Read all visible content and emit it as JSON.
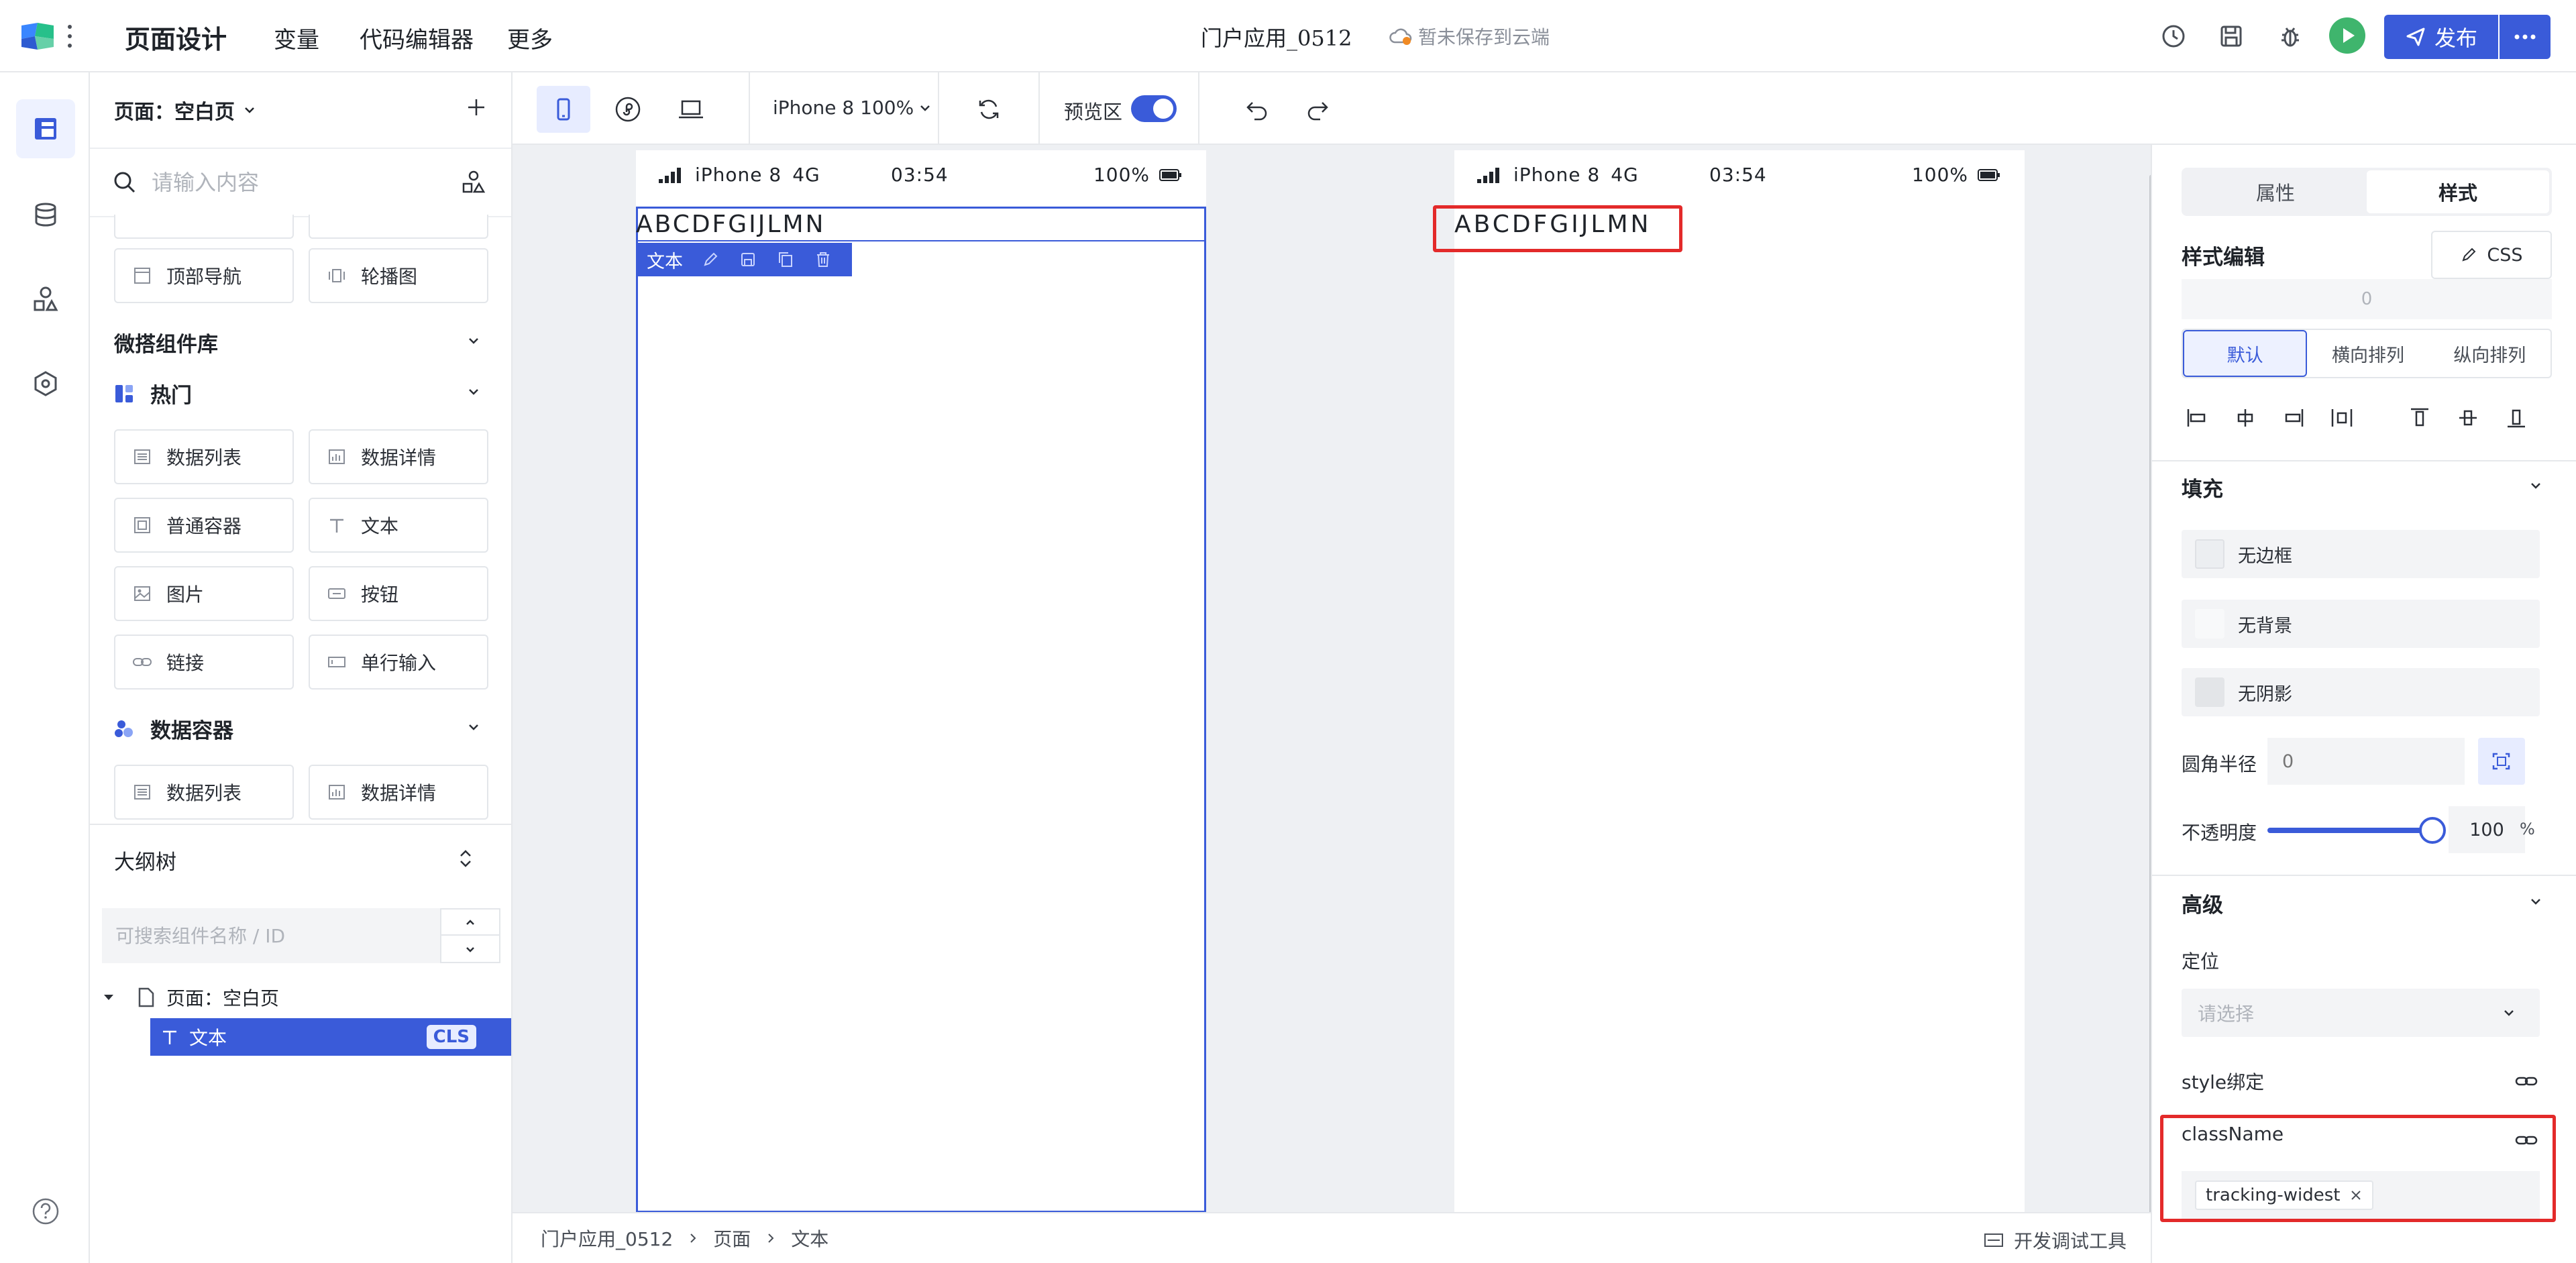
{
  "topbar": {
    "title": "页面设计",
    "menu": [
      "变量",
      "代码编辑器",
      "更多"
    ],
    "app_name": "门户应用_0512",
    "cloud_status": "暂未保存到云端",
    "publish_label": "发布"
  },
  "left_panel": {
    "page_select": "页面：空白页",
    "search_placeholder": "请输入内容",
    "top_cards": [
      "顶部导航",
      "轮播图"
    ],
    "library_title": "微搭组件库",
    "hot_title": "热门",
    "hot_cards": [
      "数据列表",
      "数据详情",
      "普通容器",
      "文本",
      "图片",
      "按钮",
      "链接",
      "单行输入"
    ],
    "data_container_title": "数据容器",
    "data_container_cards": [
      "数据列表",
      "数据详情"
    ],
    "outline_title": "大纲树",
    "outline_search_placeholder": "可搜索组件名称 / ID",
    "tree_page": "页面：空白页",
    "tree_text": "文本",
    "tree_badge": "CLS"
  },
  "canvas_toolbar": {
    "device": "iPhone 8 100%",
    "preview_label": "预览区",
    "preview_on": true
  },
  "phone": {
    "carrier": "iPhone 8",
    "network": "4G",
    "time": "03:54",
    "battery": "100%",
    "text": "ABCDFGIJLMN",
    "node_label": "文本"
  },
  "breadcrumb": {
    "items": [
      "门户应用_0512",
      "页面",
      "文本"
    ],
    "devtools": "开发调试工具"
  },
  "right_panel": {
    "tabs": [
      "属性",
      "样式"
    ],
    "active_tab": "样式",
    "style_edit_title": "样式编辑",
    "css_label": "CSS",
    "zero_value": "0",
    "layout_tabs": [
      "默认",
      "横向排列",
      "纵向排列"
    ],
    "fill_title": "填充",
    "fill_rows": [
      "无边框",
      "无背景",
      "无阴影"
    ],
    "radius_label": "圆角半径",
    "radius_value": "0",
    "opacity_label": "不透明度",
    "opacity_value": "100",
    "opacity_unit": "%",
    "advanced_title": "高级",
    "position_label": "定位",
    "position_placeholder": "请选择",
    "style_bind_label": "style绑定",
    "classname_label": "className",
    "class_tag": "tracking-widest"
  },
  "colors": {
    "accent": "#3a5bd9",
    "highlight": "#e32a2a",
    "run": "#3fb56d"
  }
}
